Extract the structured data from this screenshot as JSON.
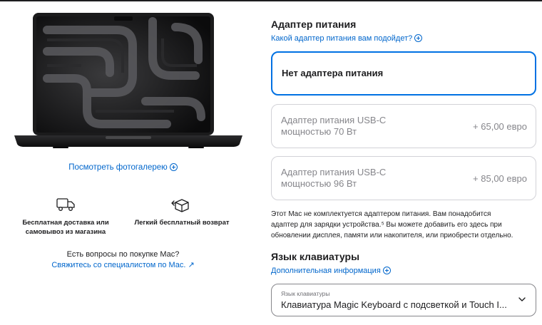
{
  "gallery": {
    "link_label": "Посмотреть фотогалерею"
  },
  "features": [
    {
      "icon": "delivery-truck-icon",
      "label": "Бесплатная доставка или самовывоз из магазина"
    },
    {
      "icon": "return-box-icon",
      "label": "Легкий бесплатный возврат"
    }
  ],
  "help": {
    "question": "Есть вопросы по покупке Mac?",
    "contact_link": "Свяжитесь со специалистом по Mac. ↗"
  },
  "power_adapter": {
    "heading": "Адаптер питания",
    "help_link": "Какой адаптер питания вам подойдет?",
    "options": [
      {
        "label": "Нет адаптера питания",
        "price": "",
        "selected": true
      },
      {
        "label_line1": "Адаптер питания USB‑C",
        "label_line2": "мощностью 70 Вт",
        "price": "+ 65,00 евро",
        "selected": false
      },
      {
        "label_line1": "Адаптер питания USB‑C",
        "label_line2": "мощностью 96 Вт",
        "price": "+ 85,00 евро",
        "selected": false
      }
    ],
    "note_lines": [
      "Этот Mac не комплектуется адаптером питания. Вам понадобится",
      "адаптер для зарядки устройства.⁵ Вы можете добавить его здесь при",
      "обновлении дисплея, памяти или накопителя, или приобрести отдельно."
    ]
  },
  "keyboard": {
    "heading": "Язык клавиатуры",
    "info_link": "Дополнительная информация",
    "select_label": "Язык клавиатуры",
    "select_value": "Клавиатура Magic Keyboard с подсветкой и Touch I..."
  },
  "colors": {
    "accent": "#0071e3",
    "link": "#0066cc",
    "text": "#1d1d1f",
    "muted": "#86868b",
    "border": "#d2d2d7"
  }
}
